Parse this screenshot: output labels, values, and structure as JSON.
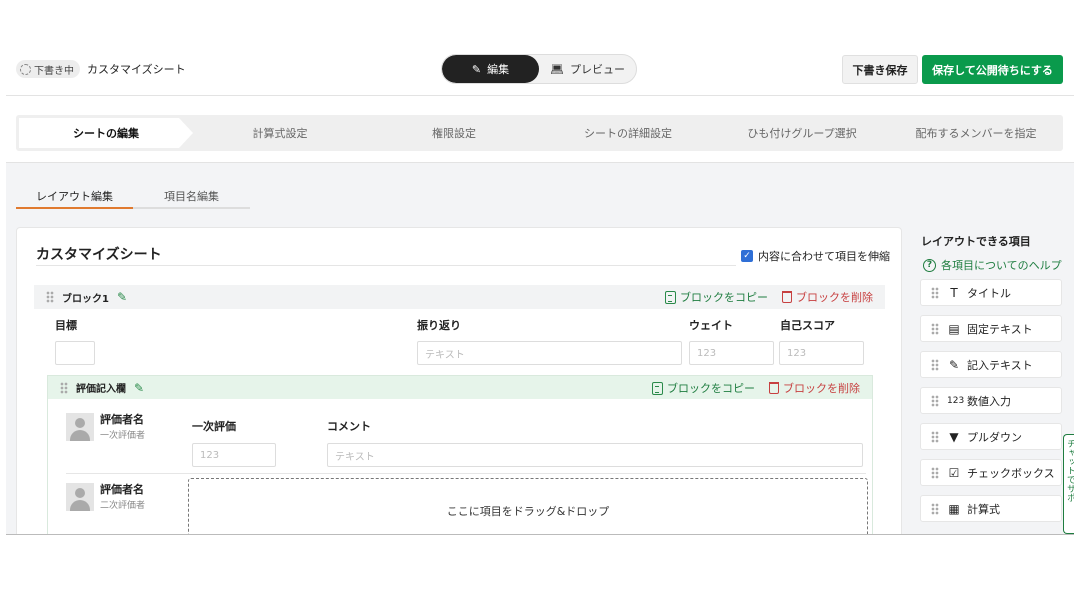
{
  "header": {
    "draft_badge": "下書き中",
    "sheet_name": "カスタマイズシート",
    "mode_edit": "編集",
    "mode_preview": "プレビュー",
    "save_draft": "下書き保存",
    "save_publish": "保存して公開待ちにする"
  },
  "steps": [
    "シートの編集",
    "計算式設定",
    "権限設定",
    "シートの詳細設定",
    "ひも付けグループ選択",
    "配布するメンバーを指定"
  ],
  "subtabs": [
    "レイアウト編集",
    "項目名編集"
  ],
  "sheet": {
    "title": "カスタマイズシート",
    "fit_label": "内容に合わせて項目を伸縮",
    "fit_checked": true
  },
  "block1": {
    "name": "ブロック1",
    "copy_label": "ブロックをコピー",
    "delete_label": "ブロックを削除",
    "columns": [
      "目標",
      "振り返り",
      "ウェイト",
      "自己スコア"
    ],
    "placeholders": {
      "text": "テキスト",
      "number": "123"
    }
  },
  "eval_block": {
    "name": "評価記入欄",
    "copy_label": "ブロックをコピー",
    "delete_label": "ブロックを削除",
    "rows": [
      {
        "name": "評価者名",
        "role": "一次評価者",
        "col1": "一次評価",
        "col2": "コメント",
        "num_placeholder": "123",
        "text_placeholder": "テキスト"
      },
      {
        "name": "評価者名",
        "role": "二次評価者"
      }
    ],
    "dropzone": "ここに項目をドラッグ&ドロップ"
  },
  "panel": {
    "title": "レイアウトできる項目",
    "help": "各項目についてのヘルプ",
    "items": [
      {
        "label": "タイトル",
        "icon": "title-icon"
      },
      {
        "label": "固定テキスト",
        "icon": "fixed-text-icon"
      },
      {
        "label": "記入テキスト",
        "icon": "input-text-icon"
      },
      {
        "label": "数値入力",
        "icon": "number-icon"
      },
      {
        "label": "プルダウン",
        "icon": "dropdown-icon"
      },
      {
        "label": "チェックボックス",
        "icon": "checkbox-icon"
      },
      {
        "label": "計算式",
        "icon": "calculator-icon"
      }
    ]
  },
  "sidetab": "チャットでサポ",
  "colors": {
    "accent_green": "#0a9a4c",
    "delete_red": "#c74040",
    "tab_orange": "#e07a2f",
    "check_blue": "#2f6fd6"
  }
}
